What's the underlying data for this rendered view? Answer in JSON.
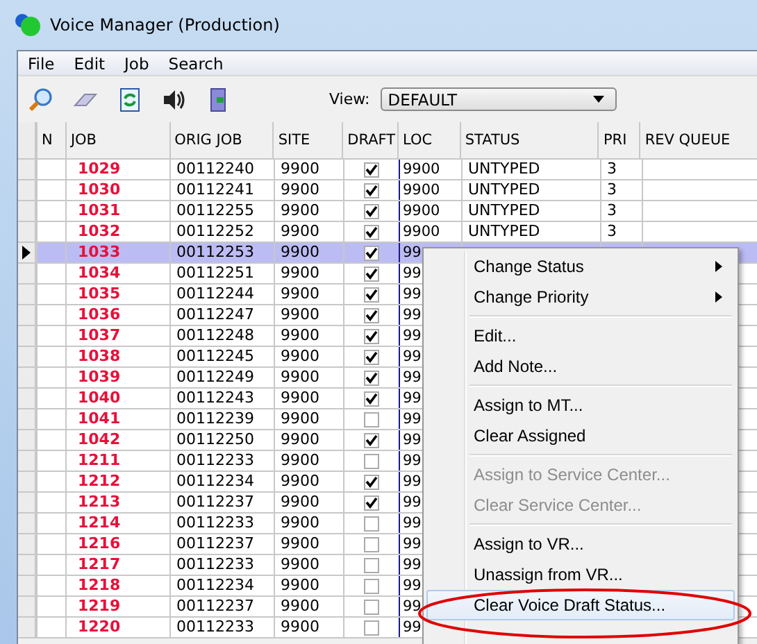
{
  "window": {
    "title": "Voice Manager (Production)"
  },
  "menu": [
    "File",
    "Edit",
    "Job",
    "Search"
  ],
  "toolbar": {
    "view_label": "View:",
    "view_value": "DEFAULT"
  },
  "table": {
    "columns": [
      "N",
      "JOB",
      "ORIG JOB",
      "SITE",
      "DRAFT",
      "LOC",
      "STATUS",
      "PRI",
      "REV QUEUE"
    ],
    "rows": [
      {
        "job": "1029",
        "orig": "00112240",
        "site": "9900",
        "draft": true,
        "loc": "9900",
        "status": "UNTYPED",
        "pri": "3",
        "selected": false
      },
      {
        "job": "1030",
        "orig": "00112241",
        "site": "9900",
        "draft": true,
        "loc": "9900",
        "status": "UNTYPED",
        "pri": "3",
        "selected": false
      },
      {
        "job": "1031",
        "orig": "00112255",
        "site": "9900",
        "draft": true,
        "loc": "9900",
        "status": "UNTYPED",
        "pri": "3",
        "selected": false
      },
      {
        "job": "1032",
        "orig": "00112252",
        "site": "9900",
        "draft": true,
        "loc": "9900",
        "status": "UNTYPED",
        "pri": "3",
        "selected": false
      },
      {
        "job": "1033",
        "orig": "00112253",
        "site": "9900",
        "draft": true,
        "loc": "99",
        "selected": true
      },
      {
        "job": "1034",
        "orig": "00112251",
        "site": "9900",
        "draft": true,
        "loc": "99",
        "selected": false
      },
      {
        "job": "1035",
        "orig": "00112244",
        "site": "9900",
        "draft": true,
        "loc": "99",
        "selected": false
      },
      {
        "job": "1036",
        "orig": "00112247",
        "site": "9900",
        "draft": true,
        "loc": "99",
        "selected": false
      },
      {
        "job": "1037",
        "orig": "00112248",
        "site": "9900",
        "draft": true,
        "loc": "99",
        "selected": false
      },
      {
        "job": "1038",
        "orig": "00112245",
        "site": "9900",
        "draft": true,
        "loc": "99",
        "selected": false
      },
      {
        "job": "1039",
        "orig": "00112249",
        "site": "9900",
        "draft": true,
        "loc": "99",
        "selected": false
      },
      {
        "job": "1040",
        "orig": "00112243",
        "site": "9900",
        "draft": true,
        "loc": "99",
        "selected": false
      },
      {
        "job": "1041",
        "orig": "00112239",
        "site": "9900",
        "draft": false,
        "loc": "99",
        "selected": false
      },
      {
        "job": "1042",
        "orig": "00112250",
        "site": "9900",
        "draft": true,
        "loc": "99",
        "selected": false
      },
      {
        "job": "1211",
        "orig": "00112233",
        "site": "9900",
        "draft": false,
        "loc": "99",
        "selected": false
      },
      {
        "job": "1212",
        "orig": "00112234",
        "site": "9900",
        "draft": true,
        "loc": "99",
        "selected": false
      },
      {
        "job": "1213",
        "orig": "00112237",
        "site": "9900",
        "draft": true,
        "loc": "99",
        "selected": false
      },
      {
        "job": "1214",
        "orig": "00112233",
        "site": "9900",
        "draft": false,
        "loc": "99",
        "selected": false
      },
      {
        "job": "1216",
        "orig": "00112237",
        "site": "9900",
        "draft": false,
        "loc": "99",
        "selected": false
      },
      {
        "job": "1217",
        "orig": "00112233",
        "site": "9900",
        "draft": false,
        "loc": "99",
        "selected": false
      },
      {
        "job": "1218",
        "orig": "00112234",
        "site": "9900",
        "draft": false,
        "loc": "99",
        "selected": false
      },
      {
        "job": "1219",
        "orig": "00112237",
        "site": "9900",
        "draft": false,
        "loc": "99",
        "selected": false
      },
      {
        "job": "1220",
        "orig": "00112233",
        "site": "9900",
        "draft": false,
        "loc": "99",
        "selected": false
      }
    ]
  },
  "context_menu": {
    "groups": [
      [
        {
          "label": "Change Status",
          "submenu": true,
          "disabled": false,
          "selected": false
        },
        {
          "label": "Change Priority",
          "submenu": true,
          "disabled": false,
          "selected": false
        }
      ],
      [
        {
          "label": "Edit...",
          "disabled": false,
          "selected": false
        },
        {
          "label": "Add Note...",
          "disabled": false,
          "selected": false
        }
      ],
      [
        {
          "label": "Assign to MT...",
          "disabled": false,
          "selected": false
        },
        {
          "label": "Clear Assigned",
          "disabled": false,
          "selected": false
        }
      ],
      [
        {
          "label": "Assign to Service Center...",
          "disabled": true,
          "selected": false
        },
        {
          "label": "Clear Service Center...",
          "disabled": true,
          "selected": false
        }
      ],
      [
        {
          "label": "Assign to VR...",
          "disabled": false,
          "selected": false
        },
        {
          "label": "Unassign from VR...",
          "disabled": false,
          "selected": false
        },
        {
          "label": "Clear Voice Draft Status...",
          "disabled": false,
          "selected": true
        }
      ]
    ]
  }
}
